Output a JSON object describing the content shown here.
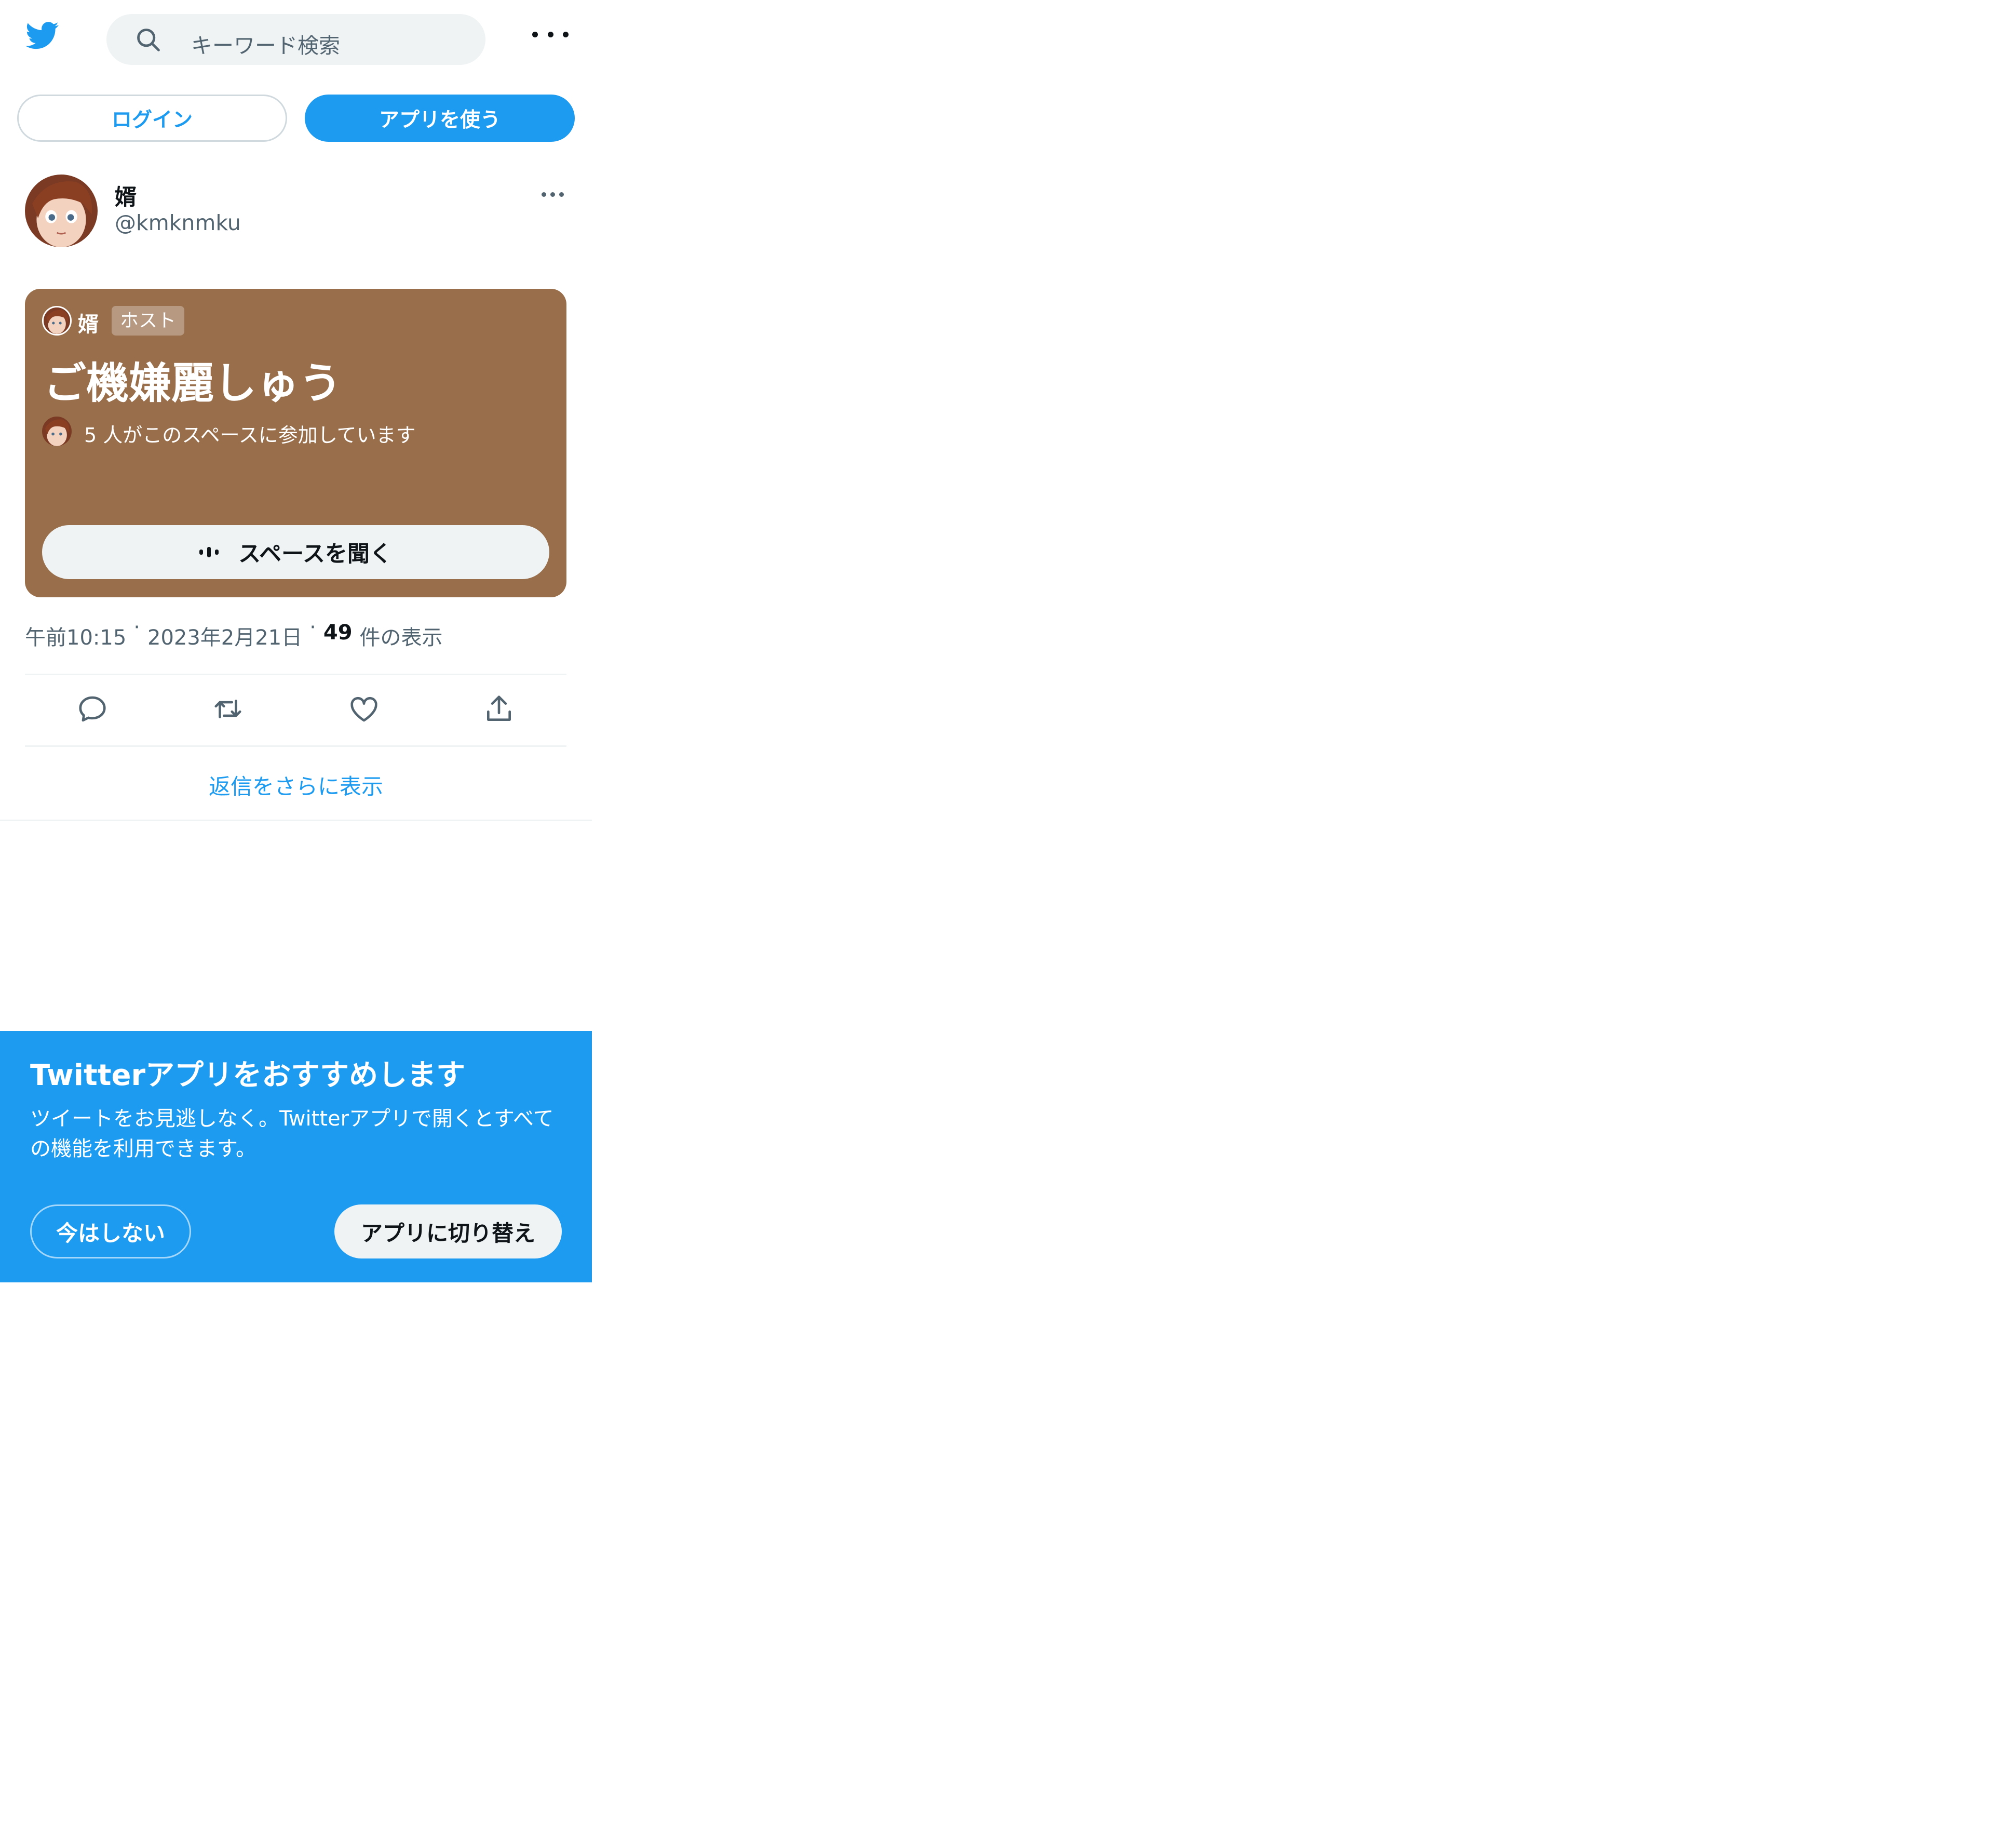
{
  "colors": {
    "accent": "#1d9bf0",
    "card_bg": "#996e4b",
    "muted": "#536471",
    "text": "#0f1419"
  },
  "header": {
    "logo_icon": "twitter-bird-icon",
    "search_placeholder": "キーワード検索",
    "more_icon": "more-horizontal-icon"
  },
  "auth": {
    "login_label": "ログイン",
    "use_app_label": "アプリを使う"
  },
  "tweet": {
    "author_name": "婿",
    "author_handle": "@kmknmku",
    "space": {
      "host_name": "婿",
      "host_badge": "ホスト",
      "title": "ご機嫌麗しゅう",
      "participants_text": "5 人がこのスペースに参加しています",
      "listen_label": "スペースを聞く"
    },
    "meta": {
      "time": "午前10:15",
      "date": "2023年2月21日",
      "views_count": "49",
      "views_label": "件の表示"
    },
    "actions": [
      "reply-icon",
      "retweet-icon",
      "like-icon",
      "share-icon"
    ]
  },
  "more_replies_label": "返信をさらに表示",
  "promo": {
    "title": "Twitterアプリをおすすめします",
    "description": "ツイートをお見逃しなく。Twitterアプリで開くとすべての機能を利用できます。",
    "not_now_label": "今はしない",
    "switch_label": "アプリに切り替え"
  }
}
